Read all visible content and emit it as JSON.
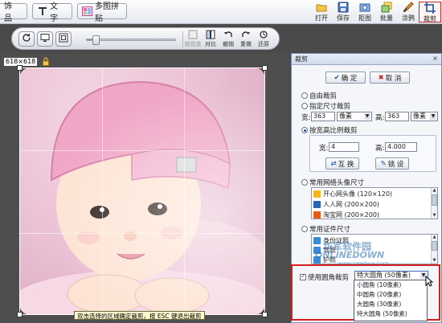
{
  "toolbar": {
    "decor_label": "饰 品",
    "text_label": "文 字",
    "collage_label": "多图拼贴",
    "right": [
      {
        "label": "打开",
        "icon": "open-folder-icon"
      },
      {
        "label": "保存",
        "icon": "save-disk-icon"
      },
      {
        "label": "拒图",
        "icon": "screenshot-icon"
      },
      {
        "label": "批量",
        "icon": "batch-icon"
      },
      {
        "label": "涂鸦",
        "icon": "brush-icon"
      },
      {
        "label": "裁剪",
        "icon": "crop-icon"
      }
    ]
  },
  "zoombar": {
    "slider_value": 0.1,
    "actions": [
      {
        "label": "换图像",
        "disabled": true
      },
      {
        "label": "对比",
        "disabled": false
      },
      {
        "label": "撤销",
        "disabled": false
      },
      {
        "label": "重做",
        "disabled": false
      },
      {
        "label": "还原",
        "disabled": false
      }
    ]
  },
  "canvas": {
    "size_label": "618×618",
    "hint": "双击选择的区域确定裁剪，按 ESC 键退出裁剪"
  },
  "panel": {
    "title": "裁剪",
    "confirm_label": "确 定",
    "cancel_label": "取 消",
    "opt_free": "自由裁剪",
    "opt_fixed": "指定尺寸裁剪",
    "width_label": "宽:",
    "width_value": "363",
    "width_unit": "像素",
    "height_label": "高:",
    "height_value": "363",
    "height_unit": "像素",
    "opt_ratio": "按宽高比例裁剪",
    "ratio_w_label": "宽:",
    "ratio_w_value": "4",
    "ratio_h_label": "高:",
    "ratio_h_value": "4.000",
    "swap_label": "互 换",
    "lock_label": "锁 设",
    "opt_avatar": "常用网络头像尺寸",
    "avatar_items": [
      {
        "label": "开心网头像 (120×120)",
        "color": "#f2b51c"
      },
      {
        "label": "人人网 (200×200)",
        "color": "#2a62b8"
      },
      {
        "label": "淘宝网 (200×200)",
        "color": "#e65b17"
      }
    ],
    "opt_id": "常用证件尺寸",
    "id_items": [
      {
        "label": "身份证照",
        "color": "#3c8ad6"
      },
      {
        "label": "驾照",
        "color": "#3c8ad6"
      },
      {
        "label": "护照",
        "color": "#3c8ad6"
      }
    ],
    "round_label": "使用圆角裁剪",
    "round_selected": "特大圆角 (50像素)",
    "round_options": [
      "小圆角 (10像素)",
      "中圆角 (20像素)",
      "大圆角 (30像素)",
      "特大圆角 (50像素)"
    ]
  },
  "watermark": {
    "cn": "华军软件园",
    "en": "ONLINEDOWN",
    "url": "www.newhua.com"
  },
  "colors": {
    "accent_red": "#d61f1f",
    "panel_border": "#7c8fb1"
  }
}
